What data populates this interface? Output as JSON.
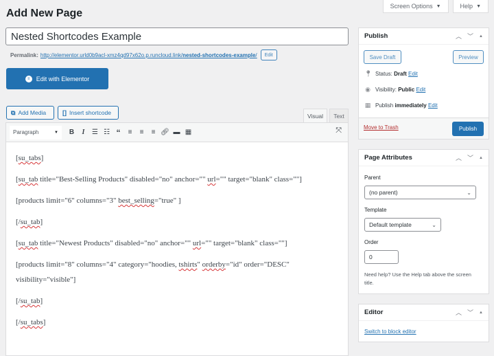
{
  "screen_meta": {
    "screen_options": "Screen Options",
    "help": "Help"
  },
  "page_title": "Add New Page",
  "post_title": "Nested Shortcodes Example",
  "permalink": {
    "label": "Permalink:",
    "base_url": "http://elementor.urld0b9acl-xmz4qd97x62o.p.runcloud.link/",
    "slug": "nested-shortcodes-example",
    "trailing": "/",
    "edit_label": "Edit"
  },
  "elementor_button": "Edit with Elementor",
  "media_buttons": {
    "add_media": "Add Media",
    "insert_shortcode": "Insert shortcode"
  },
  "editor_tabs": {
    "visual": "Visual",
    "text": "Text",
    "active": "visual"
  },
  "toolbar": {
    "format": "Paragraph",
    "buttons": [
      "bold",
      "italic",
      "bulleted-list",
      "numbered-list",
      "blockquote",
      "align-left",
      "align-center",
      "align-right",
      "insert-link",
      "read-more",
      "toolbar-toggle"
    ]
  },
  "content": {
    "lines": [
      {
        "parts": [
          "[",
          {
            "sp": "su_tabs"
          },
          "]"
        ]
      },
      {
        "parts": [
          "[",
          {
            "sp": "su_tab"
          },
          " title=\"Best-Selling Products\" disabled=\"no\" anchor=\"\" ",
          {
            "sp": "url"
          },
          "=\"\" target=\"blank\" class=\"\"]"
        ]
      },
      {
        "parts": [
          "[products limit=\"6\" columns=\"3\" ",
          {
            "sp": "best_selling"
          },
          "=\"true\" ]"
        ]
      },
      {
        "parts": [
          "[/",
          {
            "sp": "su_tab"
          },
          "]"
        ]
      },
      {
        "parts": [
          "[",
          {
            "sp": "su_tab"
          },
          " title=\"Newest Products\" disabled=\"no\" anchor=\"\" ",
          {
            "sp": "url"
          },
          "=\"\" target=\"blank\" class=\"\"]"
        ]
      },
      {
        "parts": [
          "[products limit=\"8\" columns=\"4\" category=\"hoodies, ",
          {
            "sp": "tshirts"
          },
          "\" ",
          {
            "sp": "orderby"
          },
          "=\"id\" order=\"DESC\" visibility=\"visible\"]"
        ]
      },
      {
        "parts": [
          "[/",
          {
            "sp": "su_tab"
          },
          "]"
        ]
      },
      {
        "parts": [
          "[/",
          {
            "sp": "su_tabs"
          },
          "]"
        ]
      }
    ]
  },
  "publish_box": {
    "title": "Publish",
    "save_draft": "Save Draft",
    "preview": "Preview",
    "status_label": "Status:",
    "status_value": "Draft",
    "visibility_label": "Visibility:",
    "visibility_value": "Public",
    "publish_label": "Publish",
    "publish_value": "immediately",
    "edit_link": "Edit",
    "move_to_trash": "Move to Trash",
    "publish_button": "Publish"
  },
  "page_attributes": {
    "title": "Page Attributes",
    "parent_label": "Parent",
    "parent_value": "(no parent)",
    "template_label": "Template",
    "template_value": "Default template",
    "order_label": "Order",
    "order_value": "0",
    "help": "Need help? Use the Help tab above the screen title."
  },
  "editor_box": {
    "title": "Editor",
    "switch_link": "Switch to block editor"
  },
  "colors": {
    "primary": "#2271b1",
    "danger": "#b32d2e",
    "background": "#f0f0f1"
  }
}
